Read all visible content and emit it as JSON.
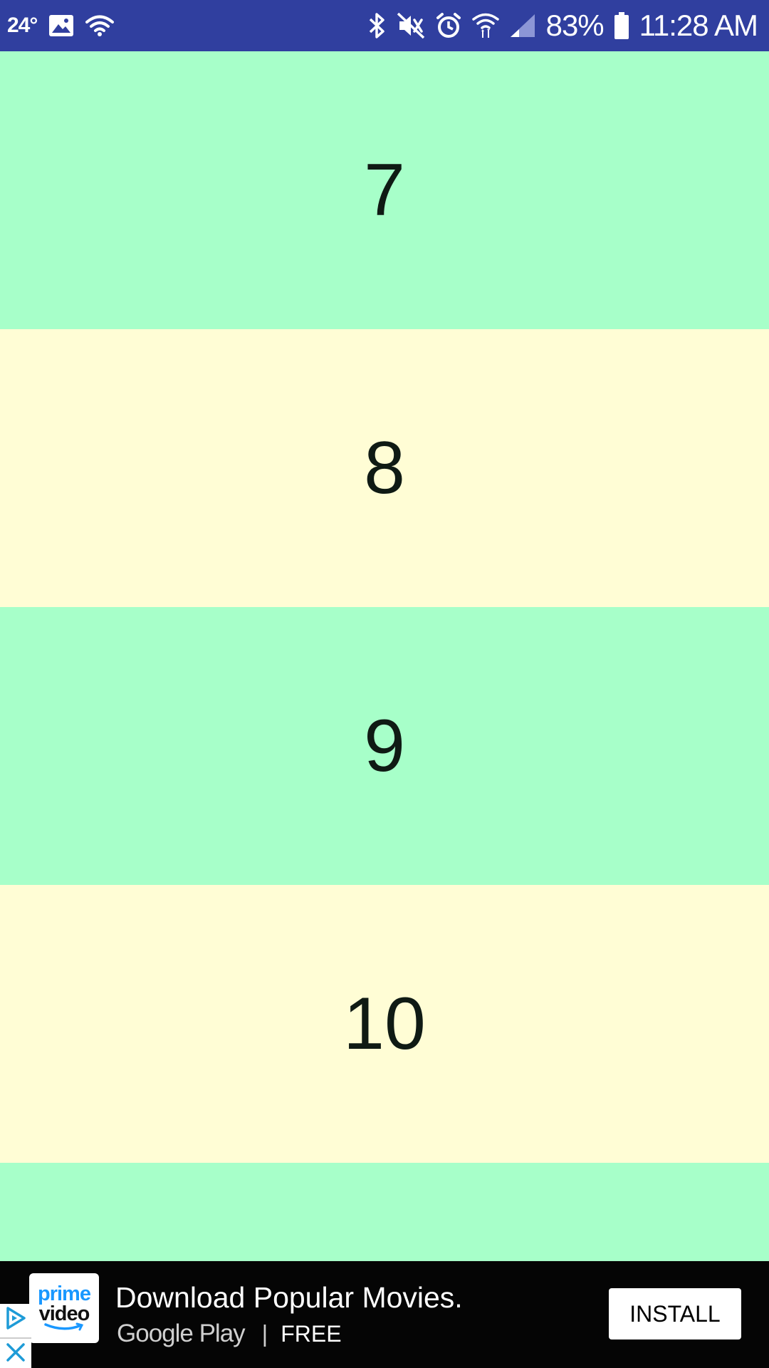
{
  "status_bar": {
    "temperature": "24°",
    "battery_percent": "83%",
    "time": "11:28 AM",
    "background_color": "#303F9F",
    "icons_left": [
      "image-icon",
      "wifi-icon"
    ],
    "icons_right": [
      "bluetooth-icon",
      "mute-icon",
      "alarm-icon",
      "wifi-data-icon",
      "signal-icon",
      "battery-icon"
    ]
  },
  "list": {
    "items": [
      {
        "label": "7",
        "color": "#A7FFC9"
      },
      {
        "label": "8",
        "color": "#FFFDD5"
      },
      {
        "label": "9",
        "color": "#A7FFC9"
      },
      {
        "label": "10",
        "color": "#FFFDD5"
      },
      {
        "label": "",
        "color": "#A7FFC9"
      }
    ]
  },
  "ad": {
    "logo_top": "prime",
    "logo_bottom": "video",
    "headline": "Download Popular Movies.",
    "store": "Google Play",
    "separator": "|",
    "price": "FREE",
    "install_label": "INSTALL",
    "icons": [
      "adchoices-icon",
      "close-icon"
    ]
  }
}
